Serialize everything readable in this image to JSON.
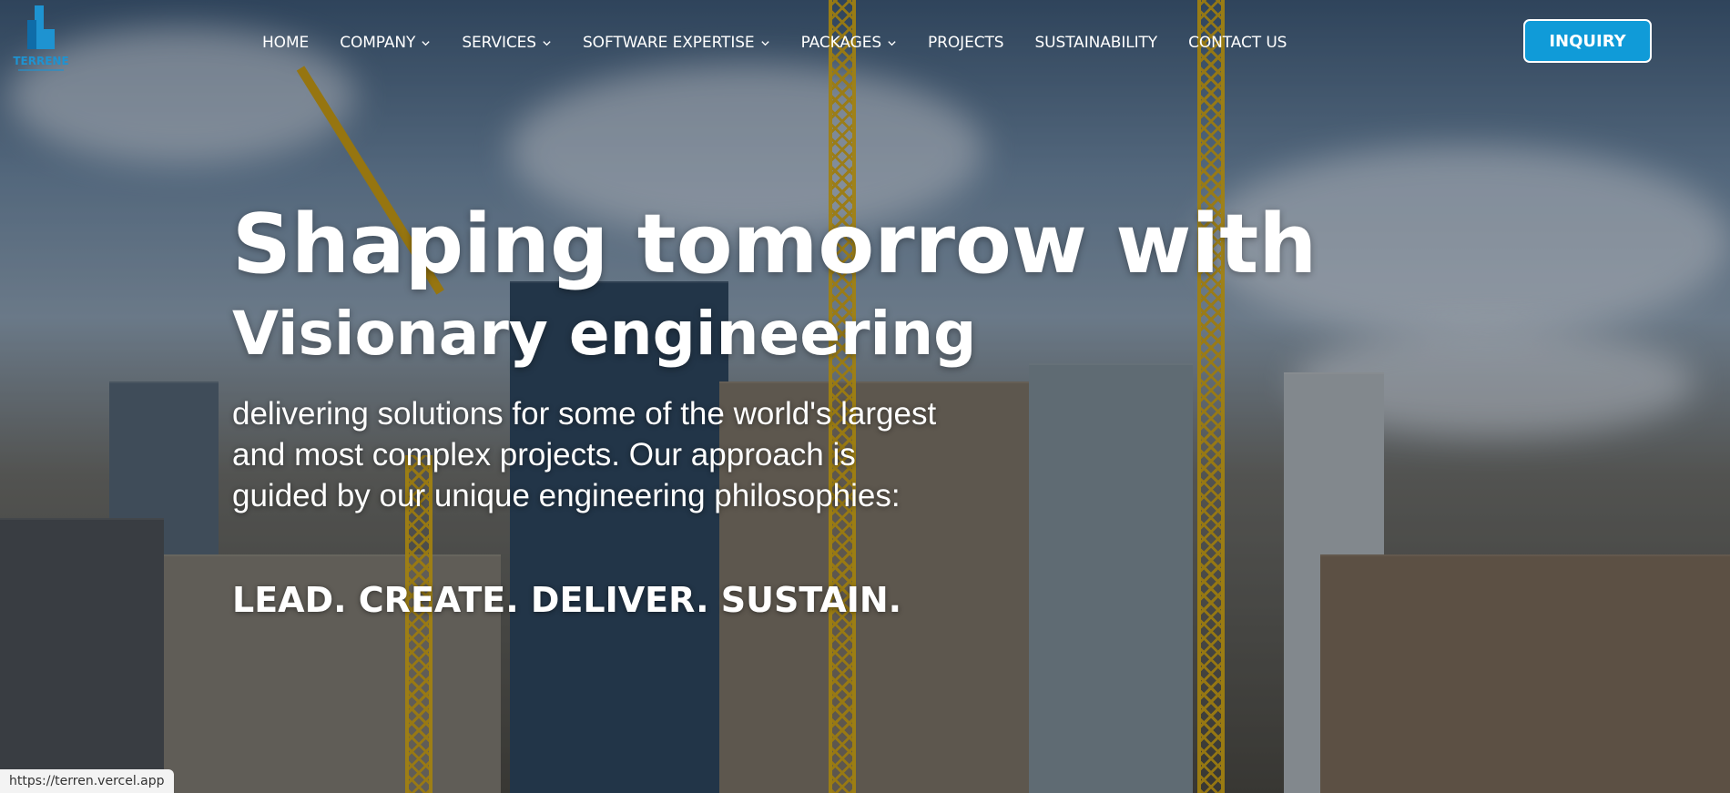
{
  "brand": {
    "logo_text": "TERRENE",
    "accent": "#109bd8"
  },
  "nav": {
    "items": [
      {
        "label": "HOME",
        "has_dropdown": false
      },
      {
        "label": "COMPANY",
        "has_dropdown": true
      },
      {
        "label": "SERVICES",
        "has_dropdown": true
      },
      {
        "label": "SOFTWARE EXPERTISE",
        "has_dropdown": true
      },
      {
        "label": "PACKAGES",
        "has_dropdown": true
      },
      {
        "label": "PROJECTS",
        "has_dropdown": false
      },
      {
        "label": "SUSTAINABILITY",
        "has_dropdown": false
      },
      {
        "label": "CONTACT US",
        "has_dropdown": false
      }
    ],
    "cta_label": "INQUIRY"
  },
  "hero": {
    "headline_1": "Shaping tomorrow with",
    "headline_2": "Visionary engineering",
    "intro": "delivering solutions for some of the world's largest\nand most complex projects. Our approach is\nguided by our unique engineering philosophies:",
    "slogan": "LEAD. CREATE. DELIVER. SUSTAIN."
  },
  "status_bar": {
    "url": "https://terren.vercel.app"
  }
}
